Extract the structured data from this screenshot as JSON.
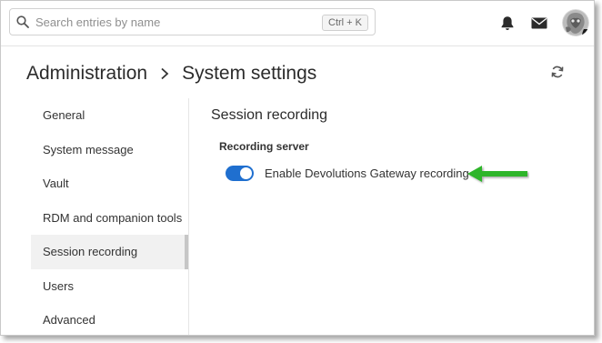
{
  "search": {
    "placeholder": "Search entries by name",
    "shortcut": "Ctrl + K"
  },
  "topbar": {
    "icons": [
      "search-icon",
      "bell-icon",
      "mail-icon",
      "avatar"
    ]
  },
  "breadcrumb": {
    "parent": "Administration",
    "current": "System settings"
  },
  "sidebar": {
    "items": [
      {
        "label": "General"
      },
      {
        "label": "System message"
      },
      {
        "label": "Vault"
      },
      {
        "label": "RDM and companion tools"
      },
      {
        "label": "Session recording",
        "active": true
      },
      {
        "label": "Users"
      },
      {
        "label": "Advanced"
      }
    ]
  },
  "main": {
    "title": "Session recording",
    "group_label": "Recording server",
    "toggle": {
      "label": "Enable Devolutions Gateway recording",
      "enabled": true
    }
  },
  "colors": {
    "accent": "#1f6fcf",
    "arrow": "#2fb52a"
  }
}
